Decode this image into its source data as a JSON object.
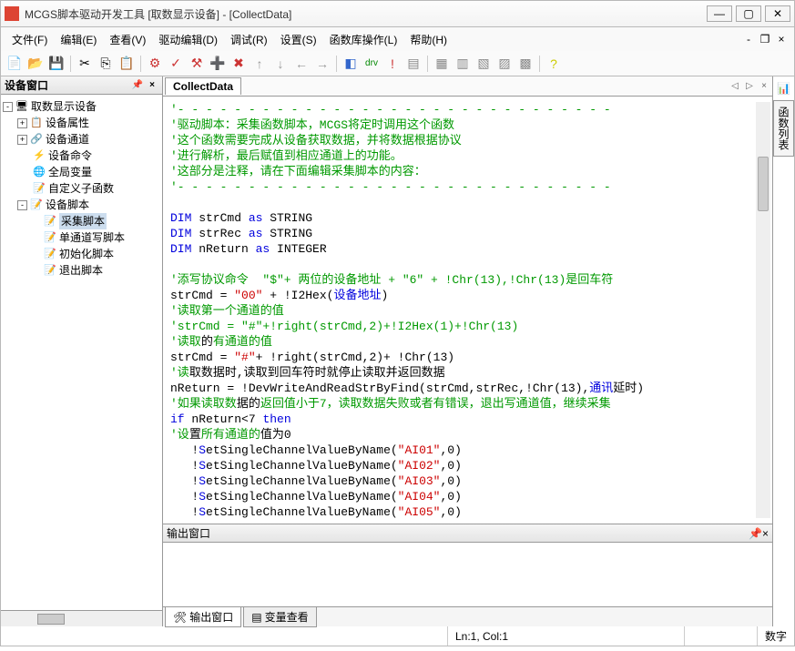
{
  "title": "MCGS脚本驱动开发工具 [取数显示设备] - [CollectData]",
  "menus": [
    "文件(F)",
    "编辑(E)",
    "查看(V)",
    "驱动编辑(D)",
    "调试(R)",
    "设置(S)",
    "函数库操作(L)",
    "帮助(H)"
  ],
  "leftTitle": "设备窗口",
  "tree": {
    "root": "取数显示设备",
    "n1": "设备属性",
    "n2": "设备通道",
    "n3": "设备命令",
    "n4": "全局变量",
    "n5": "自定义子函数",
    "n6": "设备脚本",
    "s1": "采集脚本",
    "s2": "单通道写脚本",
    "s3": "初始化脚本",
    "s4": "退出脚本"
  },
  "tabName": "CollectData",
  "outTitle": "输出窗口",
  "botTabs": {
    "out": "输出窗口",
    "var": "变量查看"
  },
  "status": {
    "pos": "Ln:1, Col:1",
    "mode": "数字"
  },
  "rightTab": "函数列表",
  "code": {
    "l1": "'- - - - - - - - - - - - - - - - - - - - - - - - - - - - - - -",
    "l2": "'驱动脚本：采集函数脚本，MCGS将定时调用这个函数",
    "l3": "'这个函数需要完成从设备获取数据，并将数据根据协议",
    "l4": "'进行解析，最后赋值到相应通道上的功能。",
    "l5": "'这部分是注释，请在下面编辑采集脚本的内容：",
    "l6": "'- - - - - - - - - - - - - - - - - - - - - - - - - - - - - - -",
    "d1a": "DIM",
    "d1b": " strCmd ",
    "d1c": "as",
    "d1d": " STRING",
    "d2a": "DIM",
    "d2b": " strRec ",
    "d2c": "as",
    "d2d": " STRING",
    "d3a": "DIM",
    "d3b": " nReturn ",
    "d3c": "as",
    "d3d": " INTEGER",
    "l7": "'添写协议命令  \"$\"+ 两位的设备地址 + \"6\" + !Chr(13),!Chr(13)是回车符",
    "l8a": "strCmd = ",
    "l8b": "\"00\"",
    "l8c": " + !I2Hex(",
    "l8d": "设备地址",
    "l8e": ")",
    "l9": "'读取第一个通道的值",
    "l10": "'strCmd = \"#\"+!right(strCmd,2)+!I2Hex(1)+!Chr(13)",
    "l11a": "'读取",
    "l11b": "的",
    "l11c": "有通道的值",
    "l12a": "strCmd = ",
    "l12b": "\"#\"",
    "l12c": "+ !right(strCmd,2)+ !Chr(13)",
    "l13a": "'读",
    "l13b": "取数据时,读取到回车符时就停止读取并返回数据",
    "l14a": "nReturn = !DevWriteAndReadStrByFind(strCmd,strRec,!Chr(13),",
    "l14b": "通讯",
    "l14c": "延时)",
    "l15a": "'如果读取数",
    "l15b": "据的",
    "l15c": "返回值小于7，读取数据失败或者有错误，退出写通道值，继续采集",
    "l16a": "if",
    "l16b": " nReturn<7 ",
    "l16c": "then",
    "l17a": "'设",
    "l17b": "置",
    "l17c": "所有通道的",
    "l17d": "值为0",
    "s1a": "   !",
    "s1b": "S",
    "s1c": "etSingleChannelValueByName(",
    "s1d": "\"AI01\"",
    "s1e": ",0)",
    "s2d": "\"AI02\"",
    "s3d": "\"AI03\"",
    "s4d": "\"AI04\"",
    "s5d": "\"AI05\""
  }
}
